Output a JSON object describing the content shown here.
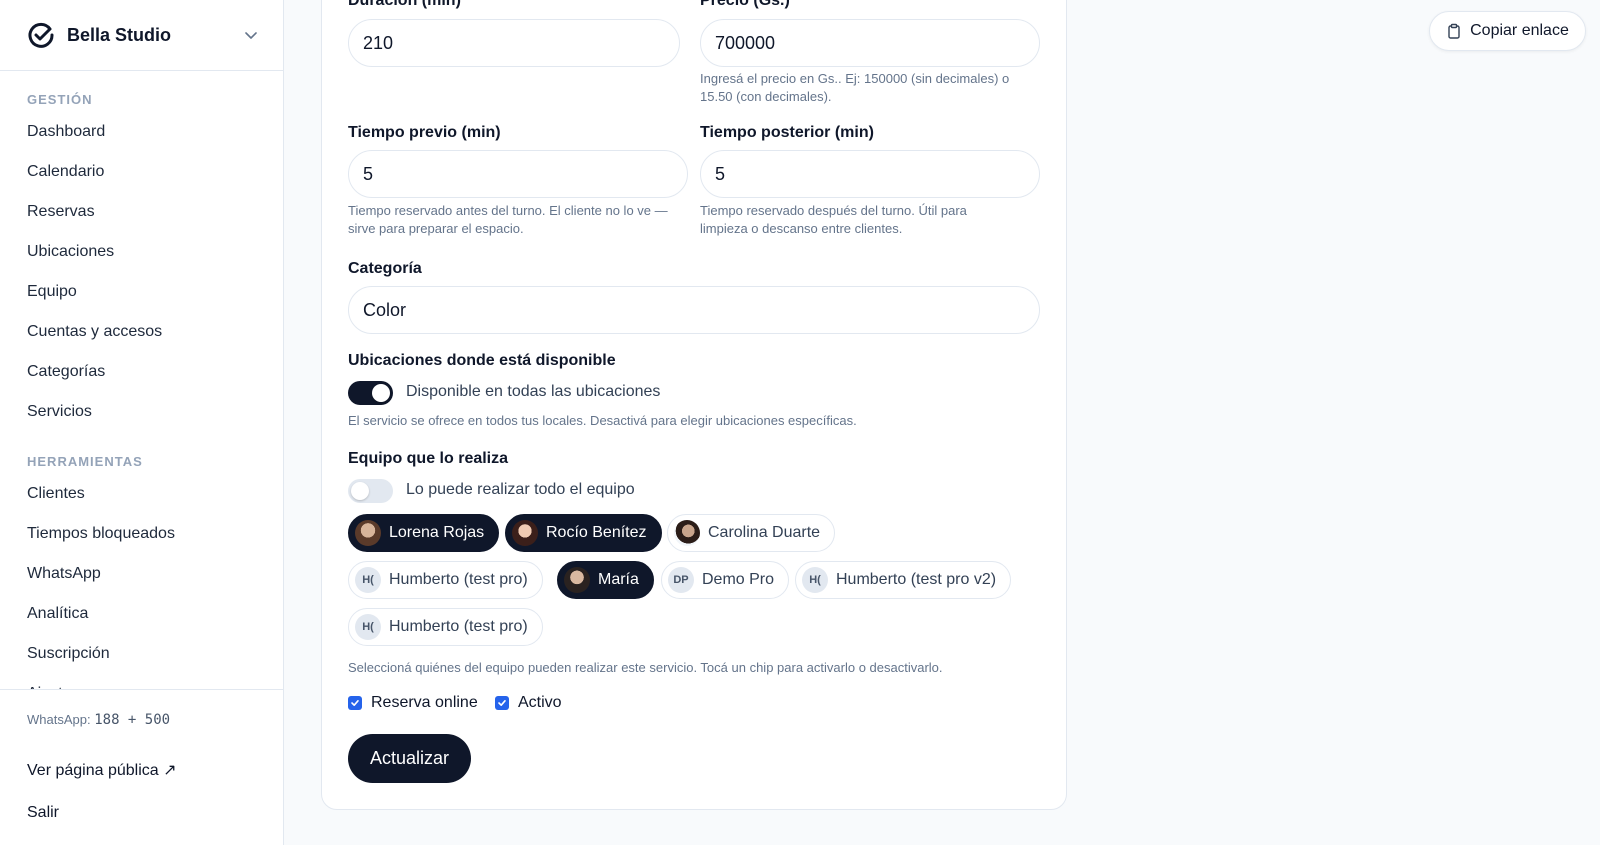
{
  "sidebar": {
    "brand": "Bella Studio",
    "section_management": "GESTIÓN",
    "management_items": [
      "Dashboard",
      "Calendario",
      "Reservas",
      "Ubicaciones",
      "Equipo",
      "Cuentas y accesos",
      "Categorías",
      "Servicios"
    ],
    "section_tools": "HERRAMIENTAS",
    "tools_items": [
      "Clientes",
      "Tiempos bloqueados",
      "WhatsApp",
      "Analítica",
      "Suscripción",
      "Ajustes"
    ],
    "whatsapp_label": "WhatsApp:",
    "whatsapp_value": "188 + 500",
    "public_page": "Ver página pública ↗",
    "logout": "Salir"
  },
  "header": {
    "copy_link": "Copiar enlace"
  },
  "form": {
    "duration_label": "Duración (min)",
    "duration_value": "210",
    "price_label": "Precio (Gs.)",
    "price_value": "700000",
    "price_help": "Ingresá el precio en Gs.. Ej: 150000 (sin decimales) o 15.50 (con decimales).",
    "before_label": "Tiempo previo (min)",
    "before_value": "5",
    "before_help": "Tiempo reservado antes del turno. El cliente no lo ve — sirve para preparar el espacio.",
    "after_label": "Tiempo posterior (min)",
    "after_value": "5",
    "after_help": "Tiempo reservado después del turno. Útil para limpieza o descanso entre clientes.",
    "category_label": "Categoría",
    "category_value": "Color",
    "locations_label": "Ubicaciones donde está disponible",
    "locations_toggle": "Disponible en todas las ubicaciones",
    "locations_toggle_on": true,
    "locations_help": "El servicio se ofrece en todos tus locales. Desactivá para elegir ubicaciones específicas.",
    "team_label": "Equipo que lo realiza",
    "team_toggle": "Lo puede realizar todo el equipo",
    "team_toggle_on": false,
    "team_members": [
      {
        "name": "Lorena Rojas",
        "active": true,
        "avatar": "photo"
      },
      {
        "name": "Rocío Benítez",
        "active": true,
        "avatar": "photo"
      },
      {
        "name": "Carolina Duarte",
        "active": false,
        "avatar": "photo"
      },
      {
        "name": "Humberto (test pro)",
        "active": false,
        "avatar": "H("
      },
      {
        "name": "María",
        "active": true,
        "avatar": "photo"
      },
      {
        "name": "Demo Pro",
        "active": false,
        "avatar": "DP"
      },
      {
        "name": "Humberto (test pro v2)",
        "active": false,
        "avatar": "H("
      },
      {
        "name": "Humberto (test pro)",
        "active": false,
        "avatar": "H("
      }
    ],
    "team_help": "Seleccioná quiénes del equipo pueden realizar este servicio. Tocá un chip para activarlo o desactivarlo.",
    "online_booking": "Reserva online",
    "online_booking_checked": true,
    "active": "Activo",
    "active_checked": true,
    "submit": "Actualizar"
  },
  "colors": {
    "primary": "#0f172a",
    "checkbox": "#2563eb",
    "border": "#e2e8f0",
    "muted": "#64748b"
  }
}
